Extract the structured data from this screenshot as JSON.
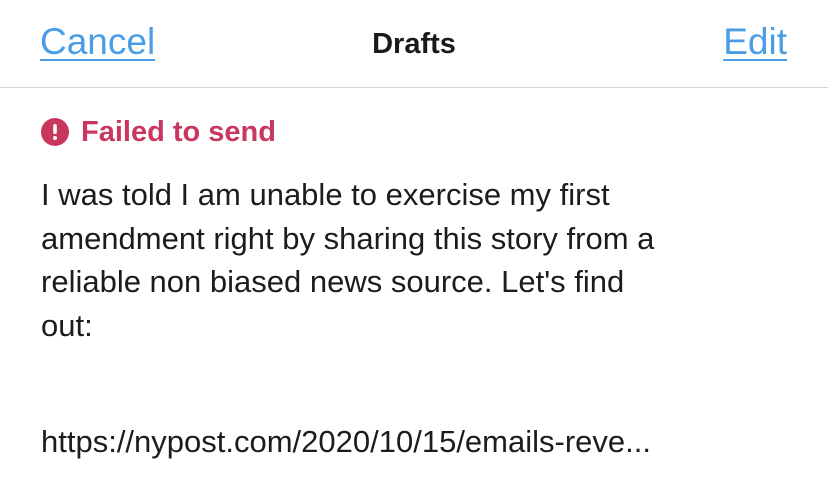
{
  "nav": {
    "cancel_label": "Cancel",
    "title": "Drafts",
    "edit_label": "Edit"
  },
  "draft": {
    "status_icon": "exclamation-circle-icon",
    "status_text": "Failed to send",
    "status_color": "#c8385e",
    "text_lines": [
      "I was told I am unable to exercise my first",
      "amendment right by sharing this story from a",
      "reliable non biased news source. Let's find",
      "out:"
    ],
    "link": "https://nypost.com/2020/10/15/emails-reve..."
  },
  "colors": {
    "accent": "#4a9de6",
    "error": "#c8385e",
    "divider": "#d4d4d8"
  }
}
